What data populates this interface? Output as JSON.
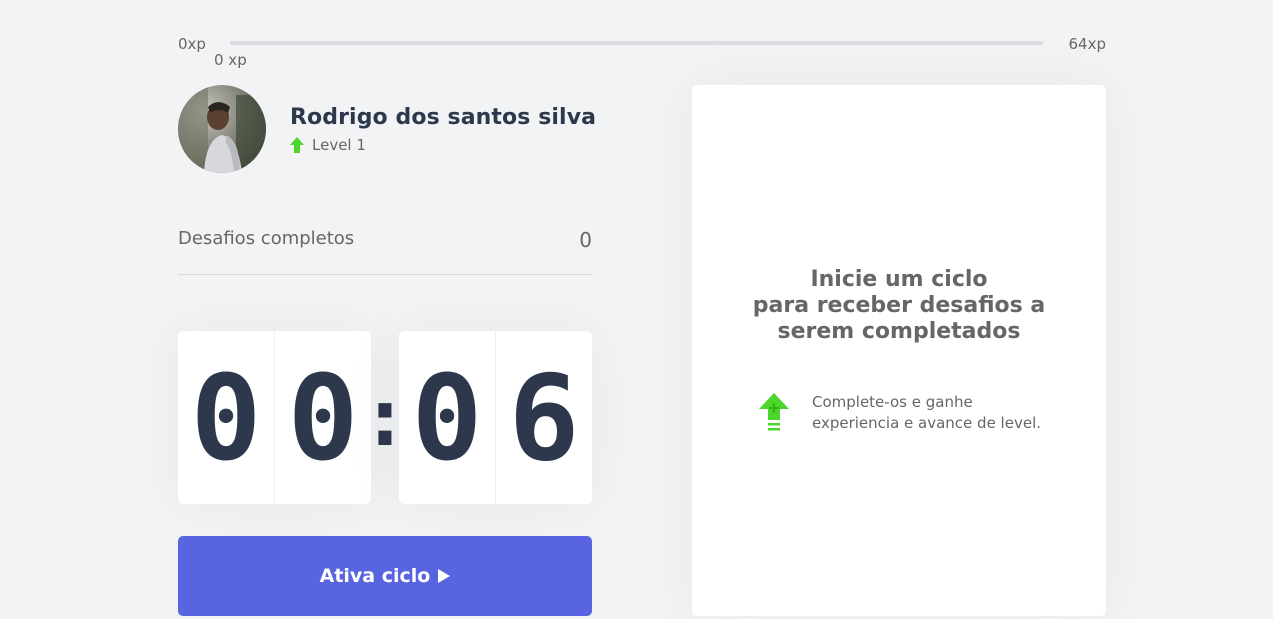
{
  "xp": {
    "min_label": "0xp",
    "max_label": "64xp",
    "current_label": "0 xp",
    "progress_fraction": 0
  },
  "profile": {
    "name": "Rodrigo dos santos silva",
    "level_label": "Level 1",
    "avatar_icon": "user-photo",
    "level_icon": "level-up-arrow-icon"
  },
  "completed": {
    "label": "Desafios completos",
    "count": "0"
  },
  "countdown": {
    "minute_left": "0",
    "minute_right": "0",
    "separator": ":",
    "second_left": "0",
    "second_right": "6"
  },
  "cycle_button": {
    "label": "Ativa ciclo",
    "icon": "play-icon"
  },
  "challenge_card": {
    "title_lines": [
      "Inicie um ciclo",
      "para receber desafios a",
      "serem completados"
    ],
    "hint_lines": [
      "Complete-os e ganhe",
      "experiencia e avance de level."
    ],
    "hint_icon": "level-up-icon"
  },
  "colors": {
    "accent_blue": "#5965e0",
    "accent_green": "#4cd62b",
    "text_dark": "#2e384d",
    "text": "#666666",
    "background": "#f2f3f5"
  }
}
